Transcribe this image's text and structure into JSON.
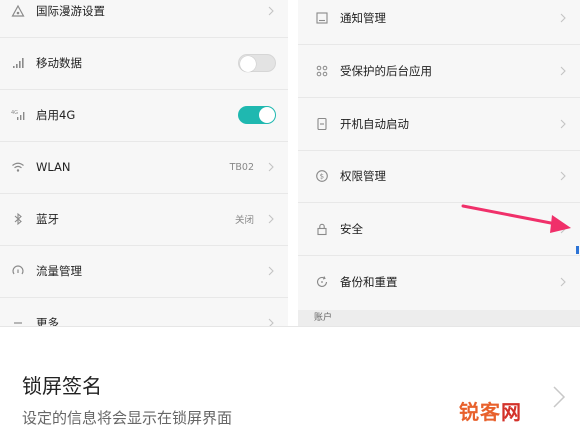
{
  "left_panel": {
    "items": [
      {
        "label": "国际漫游设置",
        "icon": "triangle-network-icon",
        "control": "chevron"
      },
      {
        "label": "移动数据",
        "icon": "signal-icon",
        "control": "toggle",
        "toggle_on": false
      },
      {
        "label": "启用4G",
        "icon": "4g-signal-icon",
        "control": "toggle",
        "toggle_on": true
      },
      {
        "label": "WLAN",
        "icon": "wifi-icon",
        "control": "chevron",
        "value": "TB02"
      },
      {
        "label": "蓝牙",
        "icon": "bluetooth-icon",
        "control": "chevron",
        "value": "关闭"
      },
      {
        "label": "流量管理",
        "icon": "data-usage-icon",
        "control": "chevron"
      },
      {
        "label": "更多",
        "icon": "more-icon",
        "control": "chevron"
      }
    ]
  },
  "right_panel": {
    "items": [
      {
        "label": "通知管理",
        "icon": "notification-icon"
      },
      {
        "label": "受保护的后台应用",
        "icon": "apps-grid-icon"
      },
      {
        "label": "开机自动启动",
        "icon": "autostart-icon"
      },
      {
        "label": "权限管理",
        "icon": "permission-icon"
      },
      {
        "label": "安全",
        "icon": "lock-icon"
      },
      {
        "label": "备份和重置",
        "icon": "backup-icon"
      }
    ],
    "section_header": "账户"
  },
  "bottom": {
    "title": "锁屏签名",
    "subtitle": "设定的信息将会显示在锁屏界面"
  },
  "watermark": {
    "part1": "锐",
    "part2": "客",
    "part3": "网"
  },
  "colors": {
    "toggle_on": "#1fb8b0",
    "arrow": "#f0306a",
    "watermark": "#e8612c"
  }
}
